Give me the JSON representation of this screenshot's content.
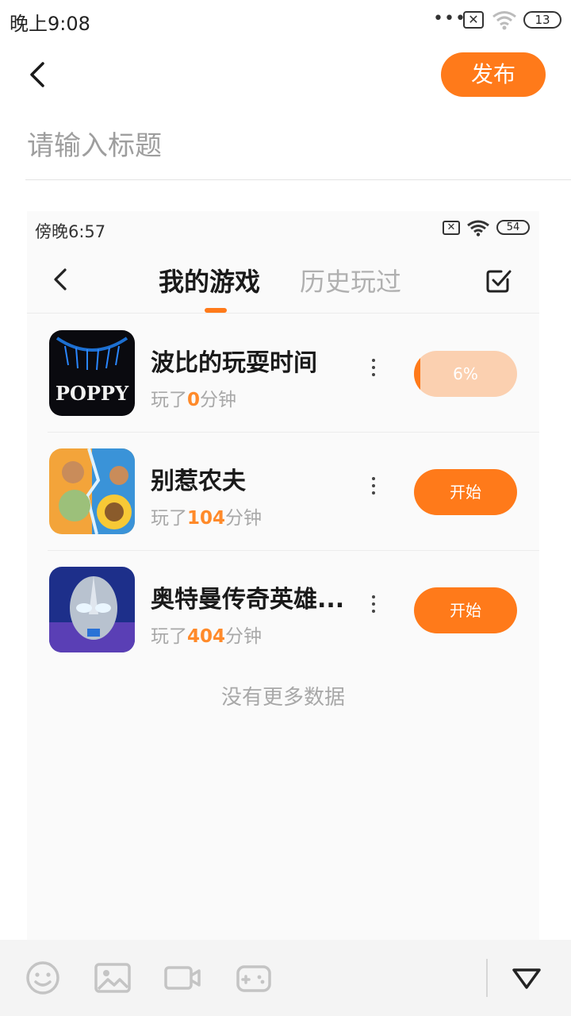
{
  "status_bar": {
    "time": "晚上9:08",
    "battery": "13"
  },
  "header": {
    "publish_label": "发布"
  },
  "title_field": {
    "placeholder": "请输入标题",
    "value": ""
  },
  "screenshot": {
    "status_bar": {
      "time": "傍晚6:57",
      "battery": "54"
    },
    "tabs": [
      {
        "label": "我的游戏",
        "active": true
      },
      {
        "label": "历史玩过",
        "active": false
      }
    ],
    "games": [
      {
        "name": "波比的玩耍时间",
        "play_prefix": "玩了",
        "play_minutes": "0",
        "play_suffix": "分钟",
        "action": "6%",
        "progress": 0.06,
        "icon": "poppy-playtime-icon"
      },
      {
        "name": "别惹农夫",
        "play_prefix": "玩了",
        "play_minutes": "104",
        "play_suffix": "分钟",
        "action": "开始",
        "icon": "plants-vs-zombies-icon"
      },
      {
        "name": "奥特曼传奇英雄...",
        "play_prefix": "玩了",
        "play_minutes": "404",
        "play_suffix": "分钟",
        "action": "开始",
        "icon": "ultraman-icon"
      }
    ],
    "end_text": "没有更多数据"
  },
  "toolbar": {
    "icons": [
      "emoji-icon",
      "image-icon",
      "video-icon",
      "game-controller-icon",
      "collapse-triangle-icon"
    ]
  },
  "colors": {
    "accent": "#ff7a1a",
    "accent_light": "#fbd0b0"
  }
}
